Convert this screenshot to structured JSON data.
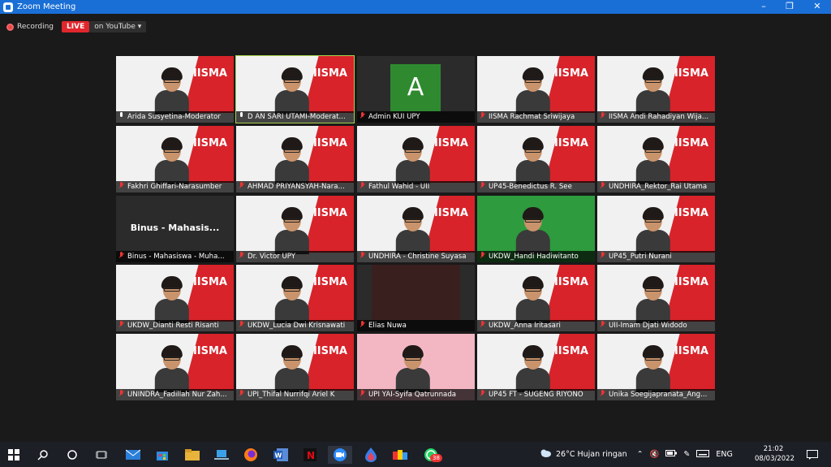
{
  "window": {
    "title": "Zoom Meeting"
  },
  "recording": {
    "label": "Recording",
    "live": "LIVE",
    "platform": "on YouTube ▾"
  },
  "tiles": [
    {
      "name": "Arida Susyetina-Moderator",
      "mic": "on",
      "kind": "video"
    },
    {
      "name": "D AN SARI UTAMI-Moderat...",
      "mic": "on",
      "kind": "video",
      "active": true
    },
    {
      "name": "Admin KUI UPY",
      "mic": "off",
      "kind": "avatar",
      "initial": "A"
    },
    {
      "name": "IISMA Rachmat Sriwijaya",
      "mic": "off",
      "kind": "video"
    },
    {
      "name": "IISMA Andi Rahadiyan Wija...",
      "mic": "off",
      "kind": "video"
    },
    {
      "name": "Fakhri Ghiffari-Narasumber",
      "mic": "off",
      "kind": "video"
    },
    {
      "name": "AHMAD PRIYANSYAH-Nara...",
      "mic": "off",
      "kind": "video"
    },
    {
      "name": "Fathul Wahid - UII",
      "mic": "off",
      "kind": "video"
    },
    {
      "name": "UP45-Benedictus R. See",
      "mic": "off",
      "kind": "video"
    },
    {
      "name": "UNDHIRA_Rektor_Rai Utama",
      "mic": "off",
      "kind": "video"
    },
    {
      "name": "Binus - Mahasiswa - Muha...",
      "mic": "off",
      "kind": "text",
      "display": "Binus - Mahasis..."
    },
    {
      "name": "Dr. Victor UPY",
      "mic": "off",
      "kind": "video"
    },
    {
      "name": "UNDHIRA - Christine Suyasa",
      "mic": "off",
      "kind": "video"
    },
    {
      "name": "UKDW_Handi Hadiwitanto",
      "mic": "off",
      "kind": "video",
      "green": true
    },
    {
      "name": "UP45_Putri Nurani",
      "mic": "off",
      "kind": "video"
    },
    {
      "name": "UKDW_Dianti Resti Risanti",
      "mic": "off",
      "kind": "video"
    },
    {
      "name": "UKDW_Lucia Dwi Krisnawati",
      "mic": "off",
      "kind": "video"
    },
    {
      "name": "Elias Nuwa",
      "mic": "off",
      "kind": "dark"
    },
    {
      "name": "UKDW_Anna Iritasari",
      "mic": "off",
      "kind": "video"
    },
    {
      "name": "UII-Imam Djati Widodo",
      "mic": "off",
      "kind": "video"
    },
    {
      "name": "UNINDRA_Fadillah Nur Zah...",
      "mic": "off",
      "kind": "video"
    },
    {
      "name": "UPI_Thifal Nurrifqi Ariel K",
      "mic": "off",
      "kind": "video"
    },
    {
      "name": "UPI YAI-Syifa Qatrunnada",
      "mic": "off",
      "kind": "video",
      "pink": true
    },
    {
      "name": "UP45 FT - SUGENG RIYONO",
      "mic": "off",
      "kind": "video"
    },
    {
      "name": "Unika Soegijapranata_Ang...",
      "mic": "off",
      "kind": "video"
    }
  ],
  "tile_logo": "IISMA",
  "taskbar": {
    "weather": "26°C  Hujan ringan",
    "lang": "ENG",
    "time": "21:02",
    "date": "08/03/2022",
    "badge": "38"
  }
}
